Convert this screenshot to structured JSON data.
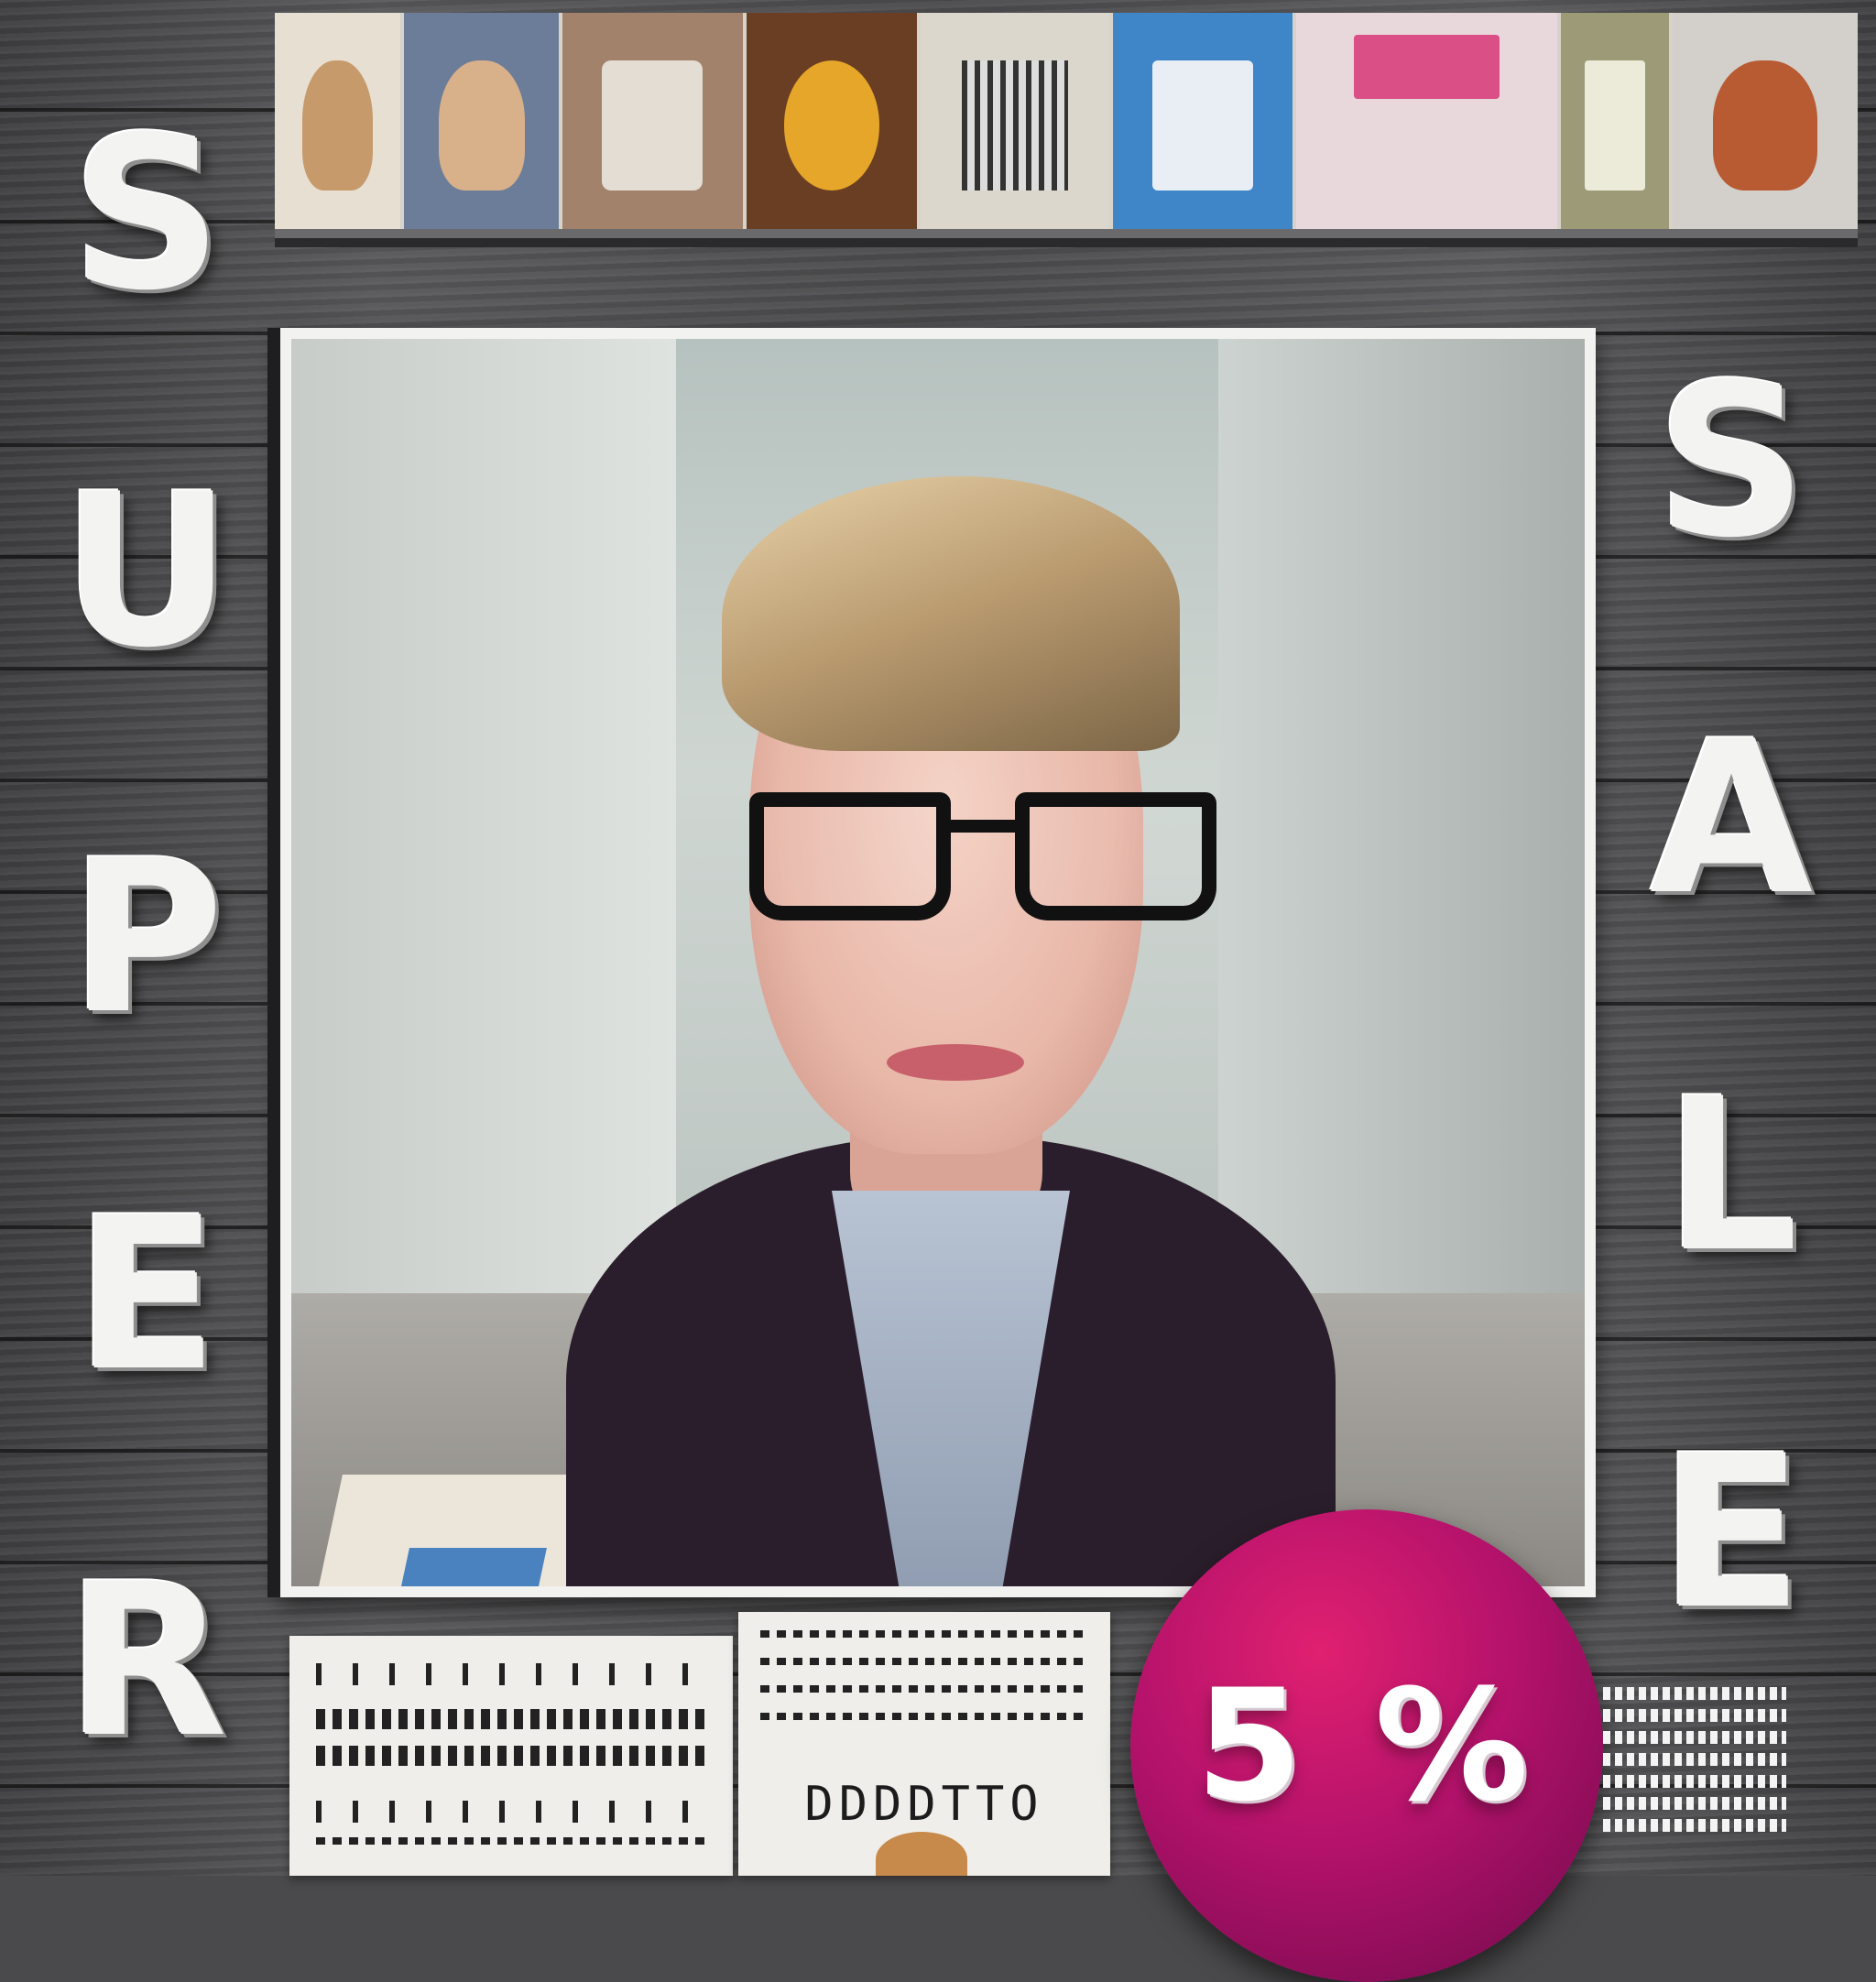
{
  "poster": {
    "headline_left": [
      "S",
      "U",
      "P",
      "E",
      "R"
    ],
    "headline_right": [
      "S",
      "A",
      "L",
      "E"
    ],
    "badge_text": "5 %",
    "paper_caption": "DDDDTTO"
  },
  "colors": {
    "background_wood": "#4a4a4c",
    "letter_fill": "#f3f3f1",
    "badge_magenta": "#b4126b",
    "frame_white": "#f2f2f0"
  },
  "top_strip": {
    "thumbnails": [
      {
        "name": "thumb-figures-1",
        "color": "#c79a6b"
      },
      {
        "name": "thumb-figures-2",
        "color": "#5b6d88"
      },
      {
        "name": "thumb-shop-window",
        "color": "#8a6a4e"
      },
      {
        "name": "thumb-box-display",
        "color": "#7b4e2c"
      },
      {
        "name": "thumb-newspaper",
        "color": "#cfcac0"
      },
      {
        "name": "thumb-blue-storefront",
        "color": "#3f86c9"
      },
      {
        "name": "thumb-pink-shop",
        "color": "#d8b4bd"
      },
      {
        "name": "thumb-kiosk",
        "color": "#a8a27a"
      },
      {
        "name": "thumb-arch-sculpture",
        "color": "#b85a32"
      }
    ]
  }
}
